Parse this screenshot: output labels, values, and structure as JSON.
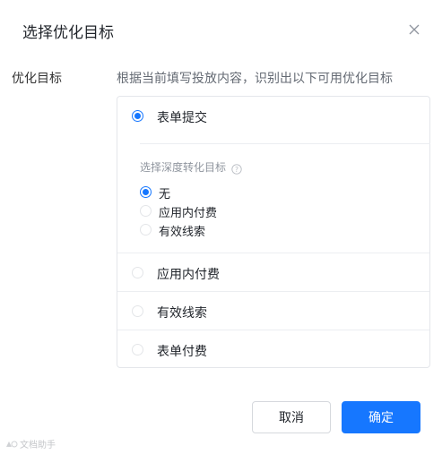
{
  "dialog": {
    "title": "选择优化目标",
    "close_icon": "close-icon"
  },
  "field": {
    "label": "优化目标",
    "hint": "根据当前填写投放内容，识别出以下可用优化目标"
  },
  "options": [
    {
      "label": "表单提交",
      "checked": true
    },
    {
      "label": "应用内付费",
      "checked": false
    },
    {
      "label": "有效线索",
      "checked": false
    },
    {
      "label": "表单付费",
      "checked": false
    }
  ],
  "deep_goal": {
    "title": "选择深度转化目标",
    "help_icon": "question-circle-icon",
    "options": [
      {
        "label": "无",
        "checked": true
      },
      {
        "label": "应用内付费",
        "checked": false
      },
      {
        "label": "有效线索",
        "checked": false
      }
    ]
  },
  "footer": {
    "cancel_label": "取消",
    "confirm_label": "确定"
  },
  "watermark": {
    "text": "文档助手"
  },
  "colors": {
    "accent": "#1677ff",
    "border": "#e4e6eb",
    "muted_text": "#8f959e"
  }
}
